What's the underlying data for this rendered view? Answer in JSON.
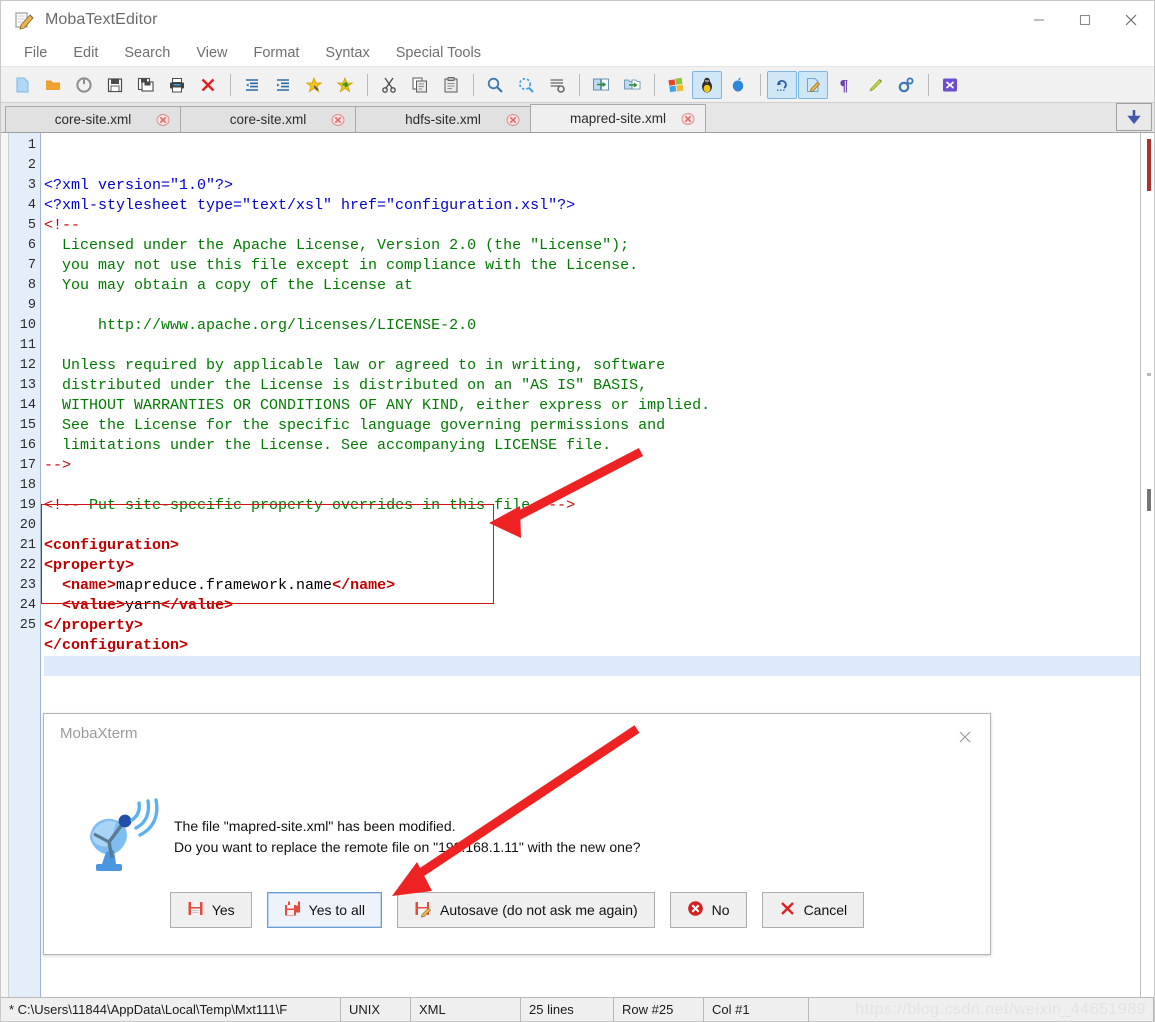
{
  "window": {
    "title": "MobaTextEditor",
    "icon": "notepad-pencil-icon",
    "controls": {
      "minimize": "minimize-icon",
      "maximize": "maximize-icon",
      "close": "close-icon"
    }
  },
  "menubar": {
    "items": [
      "File",
      "Edit",
      "Search",
      "View",
      "Format",
      "Syntax",
      "Special Tools"
    ]
  },
  "toolbar": {
    "items": [
      {
        "name": "new-file-icon",
        "selected": false
      },
      {
        "name": "open-folder-icon",
        "selected": false
      },
      {
        "name": "reload-icon",
        "selected": false
      },
      {
        "name": "save-icon",
        "selected": false
      },
      {
        "name": "save-as-icon",
        "selected": false
      },
      {
        "name": "print-icon",
        "selected": false
      },
      {
        "name": "close-file-icon",
        "selected": false
      },
      {
        "name": "separator",
        "selected": false
      },
      {
        "name": "outdent-icon",
        "selected": false
      },
      {
        "name": "indent-icon",
        "selected": false
      },
      {
        "name": "bookmark-add-icon",
        "selected": false
      },
      {
        "name": "bookmark-next-icon",
        "selected": false
      },
      {
        "name": "separator",
        "selected": false
      },
      {
        "name": "cut-icon",
        "selected": false
      },
      {
        "name": "copy-icon",
        "selected": false
      },
      {
        "name": "paste-icon",
        "selected": false
      },
      {
        "name": "separator",
        "selected": false
      },
      {
        "name": "find-icon",
        "selected": false
      },
      {
        "name": "replace-icon",
        "selected": false
      },
      {
        "name": "goto-line-icon",
        "selected": false
      },
      {
        "name": "separator",
        "selected": false
      },
      {
        "name": "compare-files-icon",
        "selected": false
      },
      {
        "name": "compare-folders-icon",
        "selected": false
      },
      {
        "name": "separator",
        "selected": false
      },
      {
        "name": "windows-format-icon",
        "selected": false
      },
      {
        "name": "linux-format-icon",
        "selected": true
      },
      {
        "name": "mac-format-icon",
        "selected": false
      },
      {
        "name": "separator",
        "selected": false
      },
      {
        "name": "undo-icon",
        "selected": true
      },
      {
        "name": "redo-edit-icon",
        "selected": true
      },
      {
        "name": "pilcrow-icon",
        "selected": false
      },
      {
        "name": "highlighter-icon",
        "selected": false
      },
      {
        "name": "settings-icon",
        "selected": false
      },
      {
        "name": "separator",
        "selected": false
      },
      {
        "name": "exit-icon",
        "selected": false
      }
    ]
  },
  "tabs": {
    "items": [
      {
        "label": "core-site.xml",
        "active": false
      },
      {
        "label": "core-site.xml",
        "active": false
      },
      {
        "label": "hdfs-site.xml",
        "active": false
      },
      {
        "label": "mapred-site.xml",
        "active": true
      }
    ],
    "nav_icon": "scroll-down-icon"
  },
  "editor": {
    "current_line": 25,
    "lines": [
      {
        "n": 1,
        "parts": [
          {
            "t": "<?xml version=\"1.0\"?>",
            "c": "pi"
          }
        ]
      },
      {
        "n": 2,
        "parts": [
          {
            "t": "<?xml-stylesheet type=\"text/xsl\" href=\"configuration.xsl\"?>",
            "c": "pi"
          }
        ]
      },
      {
        "n": 3,
        "parts": [
          {
            "t": "<!--",
            "c": "cmtd"
          }
        ]
      },
      {
        "n": 4,
        "parts": [
          {
            "t": "  Licensed under the Apache License, Version 2.0 (the \"License\");",
            "c": "cmt"
          }
        ]
      },
      {
        "n": 5,
        "parts": [
          {
            "t": "  you may not use this file except in compliance with the License.",
            "c": "cmt"
          }
        ]
      },
      {
        "n": 6,
        "parts": [
          {
            "t": "  You may obtain a copy of the License at",
            "c": "cmt"
          }
        ]
      },
      {
        "n": 7,
        "parts": [
          {
            "t": "",
            "c": "cmt"
          }
        ]
      },
      {
        "n": 8,
        "parts": [
          {
            "t": "      http://www.apache.org/licenses/LICENSE-2.0",
            "c": "cmt"
          }
        ]
      },
      {
        "n": 9,
        "parts": [
          {
            "t": "",
            "c": "cmt"
          }
        ]
      },
      {
        "n": 10,
        "parts": [
          {
            "t": "  Unless required by applicable law or agreed to in writing, software",
            "c": "cmt"
          }
        ]
      },
      {
        "n": 11,
        "parts": [
          {
            "t": "  distributed under the License is distributed on an \"AS IS\" BASIS,",
            "c": "cmt"
          }
        ]
      },
      {
        "n": 12,
        "parts": [
          {
            "t": "  WITHOUT WARRANTIES OR CONDITIONS OF ANY KIND, either express or implied.",
            "c": "cmt"
          }
        ]
      },
      {
        "n": 13,
        "parts": [
          {
            "t": "  See the License for the specific language governing permissions and",
            "c": "cmt"
          }
        ]
      },
      {
        "n": 14,
        "parts": [
          {
            "t": "  limitations under the License. See accompanying LICENSE file.",
            "c": "cmt"
          }
        ]
      },
      {
        "n": 15,
        "parts": [
          {
            "t": "-->",
            "c": "cmtd"
          }
        ]
      },
      {
        "n": 16,
        "parts": [
          {
            "t": "",
            "c": "cmt"
          }
        ]
      },
      {
        "n": 17,
        "parts": [
          {
            "t": "<!-- ",
            "c": "cmtd"
          },
          {
            "t": "Put site-specific property overrides in this file. ",
            "c": "cmt"
          },
          {
            "t": "-->",
            "c": "cmtd"
          }
        ]
      },
      {
        "n": 18,
        "parts": [
          {
            "t": "",
            "c": "cmt"
          }
        ]
      },
      {
        "n": 19,
        "parts": [
          {
            "t": "<configuration>",
            "c": "tag"
          }
        ]
      },
      {
        "n": 20,
        "parts": [
          {
            "t": "<property>",
            "c": "tag"
          }
        ]
      },
      {
        "n": 21,
        "parts": [
          {
            "t": "  <name>",
            "c": "tag"
          },
          {
            "t": "mapreduce.framework.name",
            "c": "txt"
          },
          {
            "t": "</name>",
            "c": "tag"
          }
        ]
      },
      {
        "n": 22,
        "parts": [
          {
            "t": "  <value>",
            "c": "tag"
          },
          {
            "t": "yarn",
            "c": "txt"
          },
          {
            "t": "</value>",
            "c": "tag"
          }
        ]
      },
      {
        "n": 23,
        "parts": [
          {
            "t": "</property>",
            "c": "tag"
          }
        ]
      },
      {
        "n": 24,
        "parts": [
          {
            "t": "</configuration>",
            "c": "tag"
          }
        ]
      },
      {
        "n": 25,
        "parts": [
          {
            "t": "",
            "c": "txt"
          }
        ]
      }
    ]
  },
  "dialog": {
    "title": "MobaXterm",
    "icon": "satellite-dish-icon",
    "close_icon": "close-icon",
    "message_line1": "The file \"mapred-site.xml\" has been modified.",
    "message_line2": "Do you want to replace the remote file on \"192.168.1.11\" with the new one?",
    "buttons": [
      {
        "label": "Yes",
        "icon": "save-icon",
        "focused": false
      },
      {
        "label": "Yes to all",
        "icon": "save-all-icon",
        "focused": true
      },
      {
        "label": "Autosave (do not ask me again)",
        "icon": "autosave-icon",
        "focused": false
      },
      {
        "label": "No",
        "icon": "no-icon",
        "focused": false
      },
      {
        "label": "Cancel",
        "icon": "cancel-x-icon",
        "focused": false
      }
    ]
  },
  "statusbar": {
    "file_path": "* C:\\Users\\11844\\AppData\\Local\\Temp\\Mxt111\\F",
    "line_ending": "UNIX",
    "syntax": "XML",
    "line_count": "25 lines",
    "row": "Row #25",
    "col": "Col #1"
  },
  "watermark": "https://blog.csdn.net/weixin_44651989",
  "colors": {
    "accent_selected": "#cfe6f7",
    "gutter_bg": "#e4eefb",
    "comment": "#007a00",
    "tag": "#c00000",
    "processing_instruction": "#0000d0",
    "annotation_red": "#ee2222"
  }
}
